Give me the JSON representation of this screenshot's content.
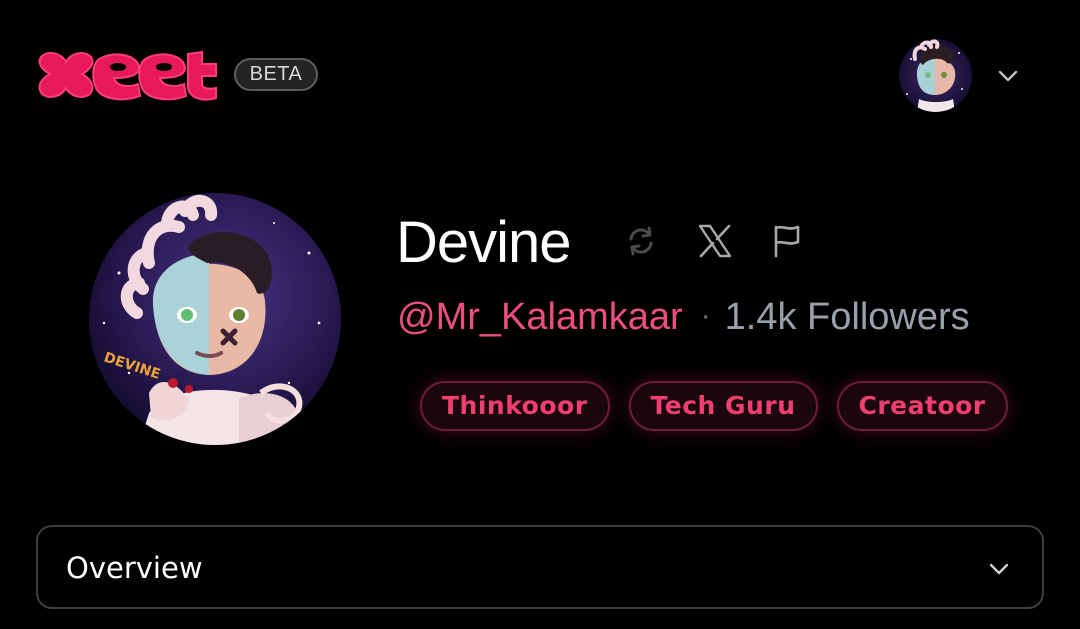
{
  "header": {
    "logo_text": "xeet",
    "badge": "BETA"
  },
  "account_menu": {
    "icon": "chevron-down-icon"
  },
  "profile": {
    "name": "Devine",
    "handle": "@Mr_Kalamkaar",
    "separator": "·",
    "followers": "1.4k Followers",
    "actions": [
      "refresh-icon",
      "x-logo-icon",
      "flag-icon"
    ],
    "tags": [
      "Thinkooor",
      "Tech Guru",
      "Creatoor"
    ]
  },
  "section": {
    "label": "Overview",
    "icon": "chevron-down-icon"
  },
  "colors": {
    "background": "#000000",
    "accent": "#ec4f7f",
    "tag_text": "#f03e70",
    "muted": "#9aa0aa"
  }
}
